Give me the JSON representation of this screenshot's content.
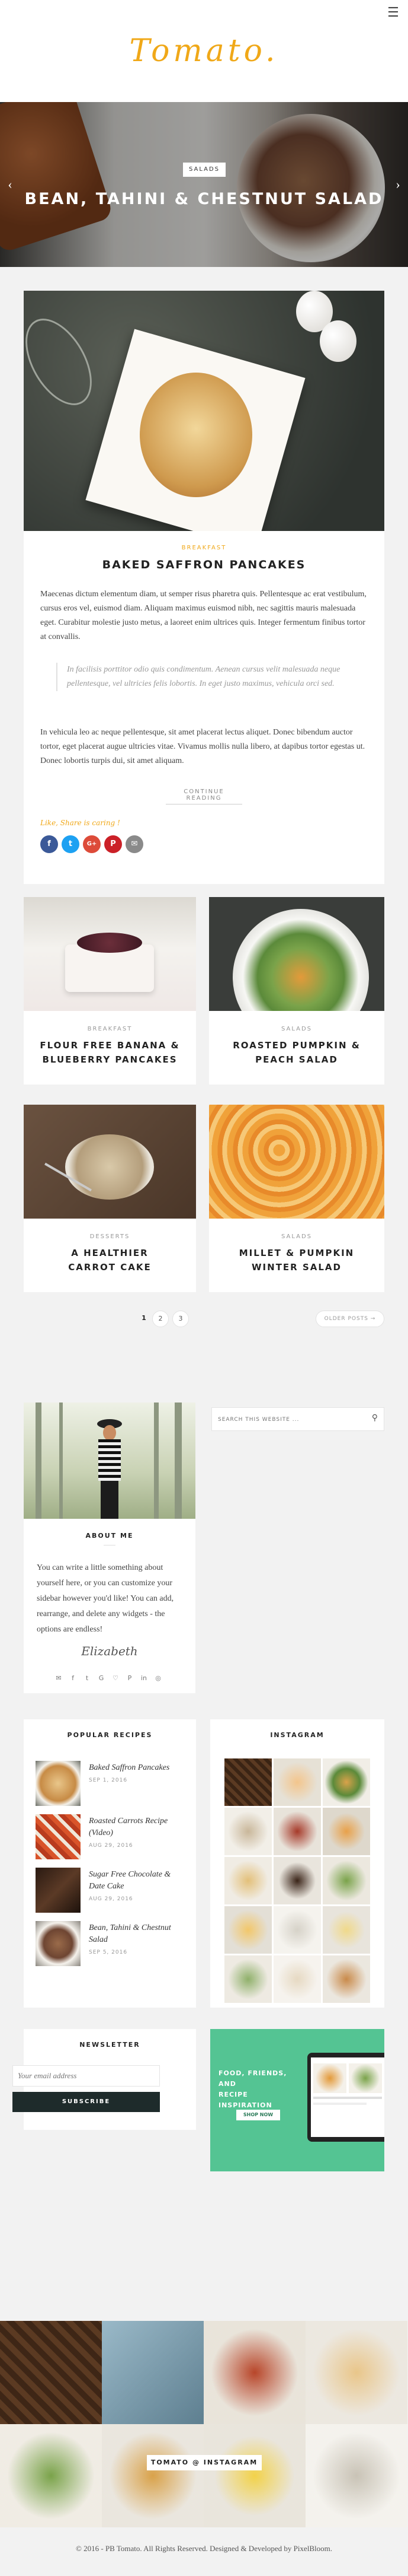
{
  "site": {
    "logo": "Tomato.",
    "menu_icon": "hamburger-icon"
  },
  "hero": {
    "tag": "SALADS",
    "title": "BEAN, TAHINI & CHESTNUT SALAD",
    "prev_icon": "chevron-left-icon",
    "next_icon": "chevron-right-icon"
  },
  "featured": {
    "category": "BREAKFAST",
    "title": "BAKED SAFFRON PANCAKES",
    "paragraph1": "Maecenas dictum elementum diam, ut semper risus pharetra quis. Pellentesque ac erat vestibulum, cursus eros vel, euismod diam. Aliquam maximus euismod nibh, nec sagittis mauris malesuada eget. Curabitur molestie justo metus, a laoreet enim ultrices quis. Integer fermentum finibus tortor at convallis.",
    "quote": "In facilisis porttitor odio quis condimentum. Aenean cursus velit malesuada neque pellentesque, vel ultricies felis lobortis. In eget justo maximus, vehicula orci sed.",
    "paragraph2": "In vehicula leo ac neque pellentesque, sit amet placerat lectus aliquet. Donec bibendum auctor tortor, eget placerat augue ultricies vitae. Vivamus mollis nulla libero, at dapibus tortor egestas ut. Donec lobortis turpis dui, sit amet aliquam.",
    "read_more": "CONTINUE READING",
    "share_label": "Like, Share is caring !",
    "share_buttons": [
      "f",
      "t",
      "G+",
      "P",
      "✉"
    ],
    "share_colors": [
      "#3b5998",
      "#1da1f2",
      "#dd4b39",
      "#cb2027",
      "#8a8a8a"
    ]
  },
  "posts": [
    {
      "category": "BREAKFAST",
      "title": "FLOUR FREE BANANA & BLUEBERRY PANCAKES"
    },
    {
      "category": "SALADS",
      "title": "ROASTED PUMPKIN & PEACH SALAD"
    },
    {
      "category": "DESSERTS",
      "title": "A HEALTHIER CARROT CAKE"
    },
    {
      "category": "SALADS",
      "title": "MILLET & PUMPKIN WINTER SALAD"
    }
  ],
  "pagination": {
    "pages": [
      "1",
      "2",
      "3"
    ],
    "current": 1,
    "older": "OLDER POSTS →"
  },
  "about": {
    "title": "ABOUT ME",
    "text": "You can write a little something about yourself here, or you can customize your sidebar however you'd like! You can add, rearrange, and delete any widgets - the options are endless!",
    "signature": "Elizabeth",
    "social": [
      "✉",
      "f",
      "t",
      "G",
      "♡",
      "P",
      "in",
      "◎"
    ]
  },
  "search": {
    "placeholder": "SEARCH THIS WEBSITE ...",
    "icon": "search-icon"
  },
  "popular": {
    "title": "POPULAR RECIPES",
    "items": [
      {
        "title": "Baked Saffron Pancakes",
        "date": "SEP 1, 2016"
      },
      {
        "title": "Roasted Carrots Recipe (Video)",
        "date": "AUG 29, 2016"
      },
      {
        "title": "Sugar Free Chocolate & Date Cake",
        "date": "AUG 29, 2016"
      },
      {
        "title": "Bean, Tahini & Chestnut Salad",
        "date": "SEP 5, 2016"
      }
    ]
  },
  "instagram": {
    "title": "INSTAGRAM"
  },
  "newsletter": {
    "title": "NEWSLETTER",
    "placeholder": "Your email address",
    "button": "SUBSCRIBE"
  },
  "ad": {
    "line1": "FOOD, FRIENDS,",
    "line2": "AND",
    "line3": "RECIPE INSPIRATION",
    "button": "SHOP NOW"
  },
  "footer_instagram": {
    "label": "TOMATO @ INSTAGRAM"
  },
  "footer": {
    "copyright": "© 2016 - PB Tomato. All Rights Reserved. Designed & Developed by PixelBloom."
  }
}
